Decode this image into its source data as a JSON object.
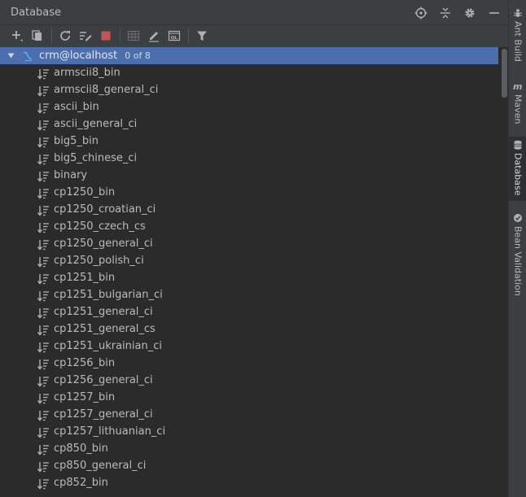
{
  "panel": {
    "title": "Database"
  },
  "title_actions": [
    {
      "name": "locate-icon"
    },
    {
      "name": "collapse-all-icon"
    },
    {
      "name": "settings-gear-icon"
    },
    {
      "name": "minimize-icon"
    }
  ],
  "toolbar": {
    "icons": [
      "add-icon",
      "duplicate-icon",
      "refresh-icon",
      "edit-schema-icon",
      "stop-icon",
      "table-icon",
      "edit-pencil-icon",
      "sql-console-icon",
      "filter-icon"
    ]
  },
  "tree": {
    "root": {
      "name": "crm@localhost",
      "count": "0 of 8",
      "expanded": true
    },
    "items": [
      "armscii8_bin",
      "armscii8_general_ci",
      "ascii_bin",
      "ascii_general_ci",
      "big5_bin",
      "big5_chinese_ci",
      "binary",
      "cp1250_bin",
      "cp1250_croatian_ci",
      "cp1250_czech_cs",
      "cp1250_general_ci",
      "cp1250_polish_ci",
      "cp1251_bin",
      "cp1251_bulgarian_ci",
      "cp1251_general_ci",
      "cp1251_general_cs",
      "cp1251_ukrainian_ci",
      "cp1256_bin",
      "cp1256_general_ci",
      "cp1257_bin",
      "cp1257_general_ci",
      "cp1257_lithuanian_ci",
      "cp850_bin",
      "cp850_general_ci",
      "cp852_bin"
    ]
  },
  "sidebar": {
    "tabs": [
      {
        "label": "Ant Build",
        "icon": "ant-icon"
      },
      {
        "label": "Maven",
        "icon": "maven-icon"
      },
      {
        "label": "Database",
        "icon": "database-icon",
        "active": true
      },
      {
        "label": "Bean Validation",
        "icon": "bean-validation-icon"
      }
    ]
  },
  "colors": {
    "selection": "#4b6eaf",
    "panel_bg": "#3c3f41",
    "tree_bg": "#2b2b2b",
    "text": "#bbbbbb",
    "stop_red": "#c75450"
  }
}
